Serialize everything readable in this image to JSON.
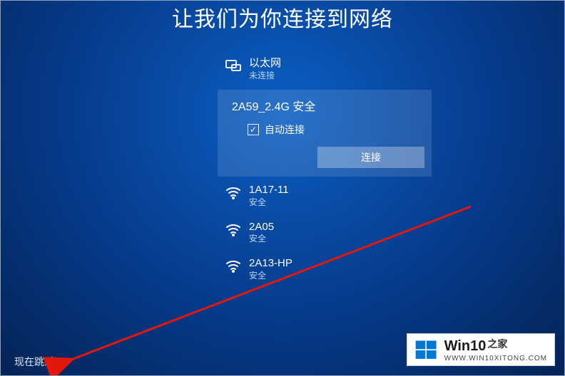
{
  "title": "让我们为你连接到网络",
  "ethernet": {
    "name": "以太网",
    "status": "未连接"
  },
  "networks": {
    "selected": {
      "name": "2A59_2.4G",
      "security": "安全"
    },
    "auto_connect_label": "自动连接",
    "auto_connect_checked": true,
    "connect_label": "连接",
    "rest": [
      {
        "name": "1A17-11",
        "security": "安全"
      },
      {
        "name": "2A05",
        "security": "安全"
      },
      {
        "name": "2A13-HP",
        "security": "安全"
      }
    ]
  },
  "skip_label": "现在跳过",
  "watermark": {
    "title_main": "Win10",
    "title_suffix": "之家",
    "url": "WWW.WIN10XITONG.COM"
  }
}
